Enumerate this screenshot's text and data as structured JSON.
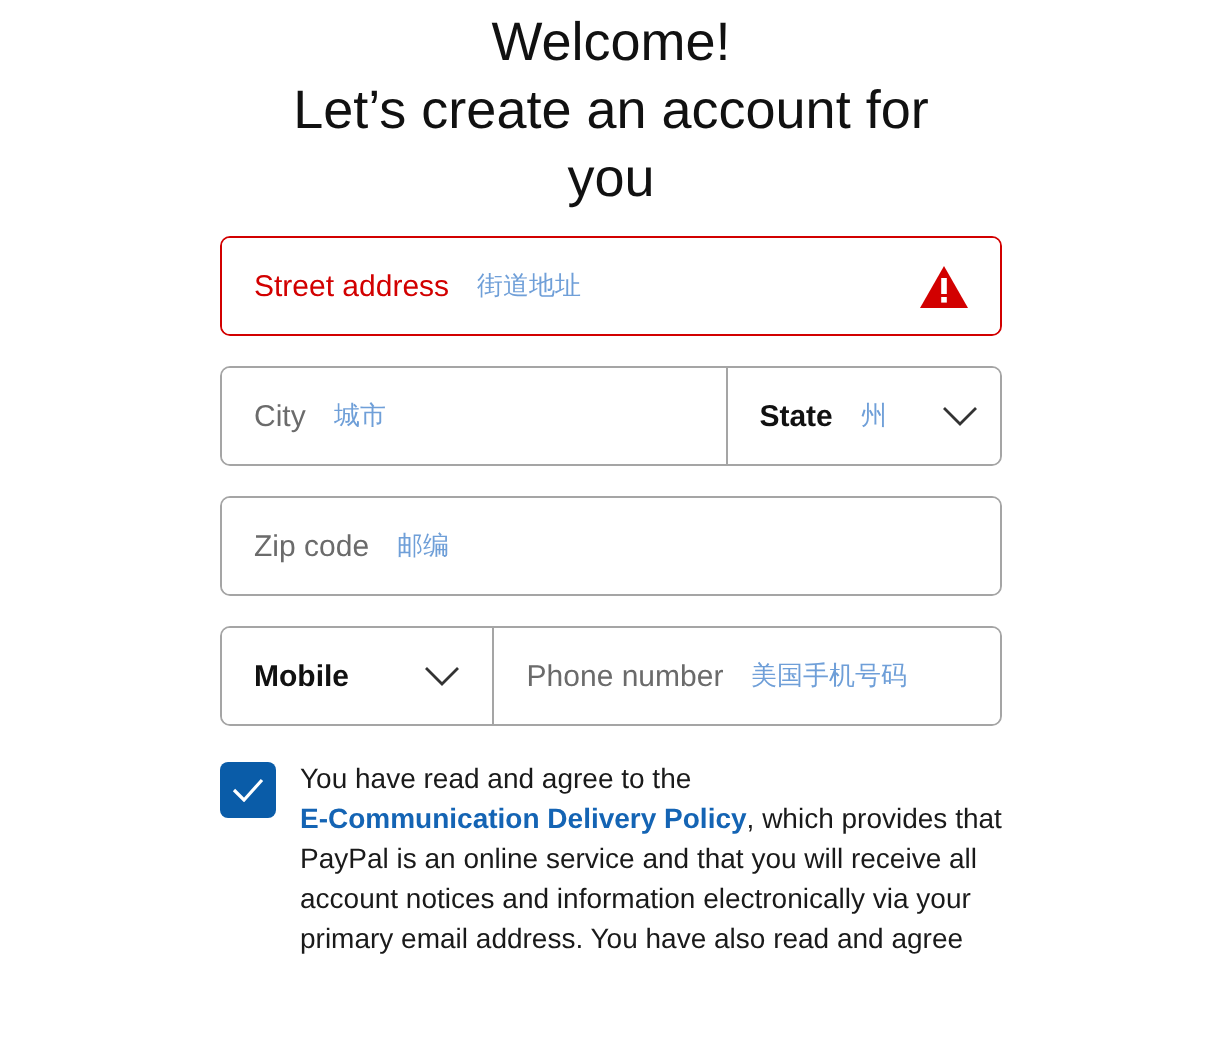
{
  "heading": [
    "Welcome!",
    "Let’s create an account for you"
  ],
  "rows": [
    {
      "fields": [
        {
          "kind": "text",
          "placeholder": "Street address",
          "hint": "街道地址",
          "error": true
        }
      ]
    },
    {
      "fields": [
        {
          "kind": "text",
          "placeholder": "City",
          "hint": "城市",
          "error": false
        },
        {
          "kind": "select",
          "value": "State",
          "hint": "州",
          "error": false
        }
      ]
    },
    {
      "fields": [
        {
          "kind": "text",
          "placeholder": "Zip code",
          "hint": "邮编",
          "error": false
        }
      ]
    },
    {
      "fields": [
        {
          "kind": "select",
          "value": "Mobile",
          "error": false
        },
        {
          "kind": "text",
          "placeholder": "Phone number",
          "hint": "美国手机号码",
          "error": false
        }
      ]
    }
  ],
  "consent": {
    "checked": true,
    "text_before": "You have read and agree to the",
    "link": "E-Communication Delivery Policy",
    "text_after": ", which provides that PayPal is an online service and that you will receive all account notices and information electronically via your primary email address. You have also read and agree"
  }
}
